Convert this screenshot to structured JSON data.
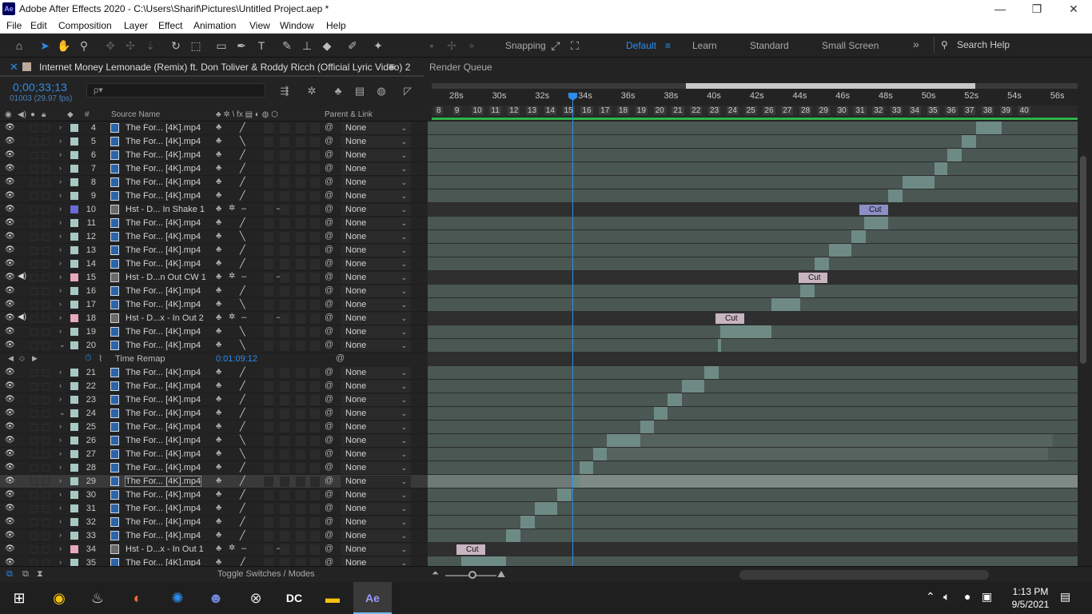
{
  "titlebar": {
    "logo": "Ae",
    "title": "Adobe After Effects 2020 - C:\\Users\\Sharif\\Pictures\\Untitled Project.aep *",
    "minimize": "—",
    "restore": "❐",
    "close": "✕"
  },
  "menu": [
    "File",
    "Edit",
    "Composition",
    "Layer",
    "Effect",
    "Animation",
    "View",
    "Window",
    "Help"
  ],
  "toolbar": {
    "snapping": "Snapping",
    "workspaces": [
      "Default",
      "Learn",
      "Standard",
      "Small Screen"
    ],
    "active_workspace": "Default",
    "search_help": "Search Help"
  },
  "panel": {
    "comp_tab": "Internet Money Lemonade (Remix) ft. Don Toliver & Roddy Ricch (Official Lyric Video) 2",
    "render_queue": "Render Queue",
    "timecode": "0;00;33;13",
    "framecode": "01003 (29.97 fps)",
    "search_placeholder": "ρ▾"
  },
  "columns": {
    "source_name": "Source Name",
    "parent_link": "Parent & Link"
  },
  "layers": [
    {
      "num": "4",
      "name": "The For... [4K].mp4",
      "type": "footage",
      "color": "#a8c8c4",
      "parent": "None",
      "twirl": "›"
    },
    {
      "num": "5",
      "name": "The For... [4K].mp4",
      "type": "footage",
      "color": "#a8c8c4",
      "parent": "None",
      "twirl": "›"
    },
    {
      "num": "6",
      "name": "The For... [4K].mp4",
      "type": "footage",
      "color": "#a8c8c4",
      "parent": "None",
      "twirl": "›"
    },
    {
      "num": "7",
      "name": "The For... [4K].mp4",
      "type": "footage",
      "color": "#a8c8c4",
      "parent": "None",
      "twirl": "›"
    },
    {
      "num": "8",
      "name": "The For... [4K].mp4",
      "type": "footage",
      "color": "#a8c8c4",
      "parent": "None",
      "twirl": "›"
    },
    {
      "num": "9",
      "name": "The For... [4K].mp4",
      "type": "footage",
      "color": "#a8c8c4",
      "parent": "None",
      "twirl": "›"
    },
    {
      "num": "10",
      "name": "Hst - D... In Shake 1",
      "type": "comp",
      "color": "#6a6ad8",
      "parent": "None",
      "twirl": "›"
    },
    {
      "num": "11",
      "name": "The For... [4K].mp4",
      "type": "footage",
      "color": "#a8c8c4",
      "parent": "None",
      "twirl": "›"
    },
    {
      "num": "12",
      "name": "The For... [4K].mp4",
      "type": "footage",
      "color": "#a8c8c4",
      "parent": "None",
      "twirl": "›"
    },
    {
      "num": "13",
      "name": "The For... [4K].mp4",
      "type": "footage",
      "color": "#a8c8c4",
      "parent": "None",
      "twirl": "›"
    },
    {
      "num": "14",
      "name": "The For... [4K].mp4",
      "type": "footage",
      "color": "#a8c8c4",
      "parent": "None",
      "twirl": "›"
    },
    {
      "num": "15",
      "name": "Hst - D...n Out CW 1",
      "type": "comp",
      "color": "#e8a8c0",
      "parent": "None",
      "twirl": "›"
    },
    {
      "num": "16",
      "name": "The For... [4K].mp4",
      "type": "footage",
      "color": "#a8c8c4",
      "parent": "None",
      "twirl": "›"
    },
    {
      "num": "17",
      "name": "The For... [4K].mp4",
      "type": "footage",
      "color": "#a8c8c4",
      "parent": "None",
      "twirl": "›"
    },
    {
      "num": "18",
      "name": "Hst - D...x - In Out 2",
      "type": "comp",
      "color": "#e8a8c0",
      "parent": "None",
      "twirl": "›"
    },
    {
      "num": "19",
      "name": "The For... [4K].mp4",
      "type": "footage",
      "color": "#a8c8c4",
      "parent": "None",
      "twirl": "›"
    },
    {
      "num": "20",
      "name": "The For... [4K].mp4",
      "type": "footage",
      "color": "#a8c8c4",
      "parent": "None",
      "twirl": "⌄"
    },
    {
      "remap": true,
      "prop": "Time Remap",
      "value": "0:01:09:12"
    },
    {
      "num": "21",
      "name": "The For... [4K].mp4",
      "type": "footage",
      "color": "#a8c8c4",
      "parent": "None",
      "twirl": "›"
    },
    {
      "num": "22",
      "name": "The For... [4K].mp4",
      "type": "footage",
      "color": "#a8c8c4",
      "parent": "None",
      "twirl": "›"
    },
    {
      "num": "23",
      "name": "The For... [4K].mp4",
      "type": "footage",
      "color": "#a8c8c4",
      "parent": "None",
      "twirl": "›"
    },
    {
      "num": "24",
      "name": "The For... [4K].mp4",
      "type": "footage",
      "color": "#a8c8c4",
      "parent": "None",
      "twirl": "⌄"
    },
    {
      "num": "25",
      "name": "The For... [4K].mp4",
      "type": "footage",
      "color": "#a8c8c4",
      "parent": "None",
      "twirl": "›"
    },
    {
      "num": "26",
      "name": "The For... [4K].mp4",
      "type": "footage",
      "color": "#a8c8c4",
      "parent": "None",
      "twirl": "›"
    },
    {
      "num": "27",
      "name": "The For... [4K].mp4",
      "type": "footage",
      "color": "#a8c8c4",
      "parent": "None",
      "twirl": "›"
    },
    {
      "num": "28",
      "name": "The For... [4K].mp4",
      "type": "footage",
      "color": "#a8c8c4",
      "parent": "None",
      "twirl": "›"
    },
    {
      "num": "29",
      "name": "The For... [4K].mp4",
      "type": "footage",
      "color": "#a8c8c4",
      "parent": "None",
      "twirl": "›",
      "selected": true
    },
    {
      "num": "30",
      "name": "The For... [4K].mp4",
      "type": "footage",
      "color": "#a8c8c4",
      "parent": "None",
      "twirl": "›"
    },
    {
      "num": "31",
      "name": "The For... [4K].mp4",
      "type": "footage",
      "color": "#a8c8c4",
      "parent": "None",
      "twirl": "›"
    },
    {
      "num": "32",
      "name": "The For... [4K].mp4",
      "type": "footage",
      "color": "#a8c8c4",
      "parent": "None",
      "twirl": "›"
    },
    {
      "num": "33",
      "name": "The For... [4K].mp4",
      "type": "footage",
      "color": "#a8c8c4",
      "parent": "None",
      "twirl": "›"
    },
    {
      "num": "34",
      "name": "Hst - D...x - In Out 1",
      "type": "comp",
      "color": "#e8a8c0",
      "parent": "None",
      "twirl": "›"
    },
    {
      "num": "35",
      "name": "The For... [4K].mp4",
      "type": "footage",
      "color": "#a8c8c4",
      "parent": "None",
      "twirl": "›"
    }
  ],
  "timeline": {
    "ruler": [
      "28s",
      "30s",
      "32s",
      "34s",
      "36s",
      "38s",
      "40s",
      "42s",
      "44s",
      "46s",
      "48s",
      "50s",
      "52s",
      "54s",
      "56s"
    ],
    "markers": [
      "8",
      "9",
      "10",
      "11",
      "12",
      "13",
      "14",
      "15",
      "16",
      "17",
      "18",
      "19",
      "20",
      "21",
      "22",
      "23",
      "24",
      "25",
      "26",
      "27",
      "28",
      "29",
      "30",
      "31",
      "32",
      "33",
      "34",
      "35",
      "36",
      "37",
      "38",
      "39",
      "40"
    ],
    "cut_label": "Cut"
  },
  "bottom": {
    "toggle": "Toggle Switches / Modes"
  },
  "taskbar": {
    "time": "1:13 PM",
    "date": "9/5/2021"
  }
}
